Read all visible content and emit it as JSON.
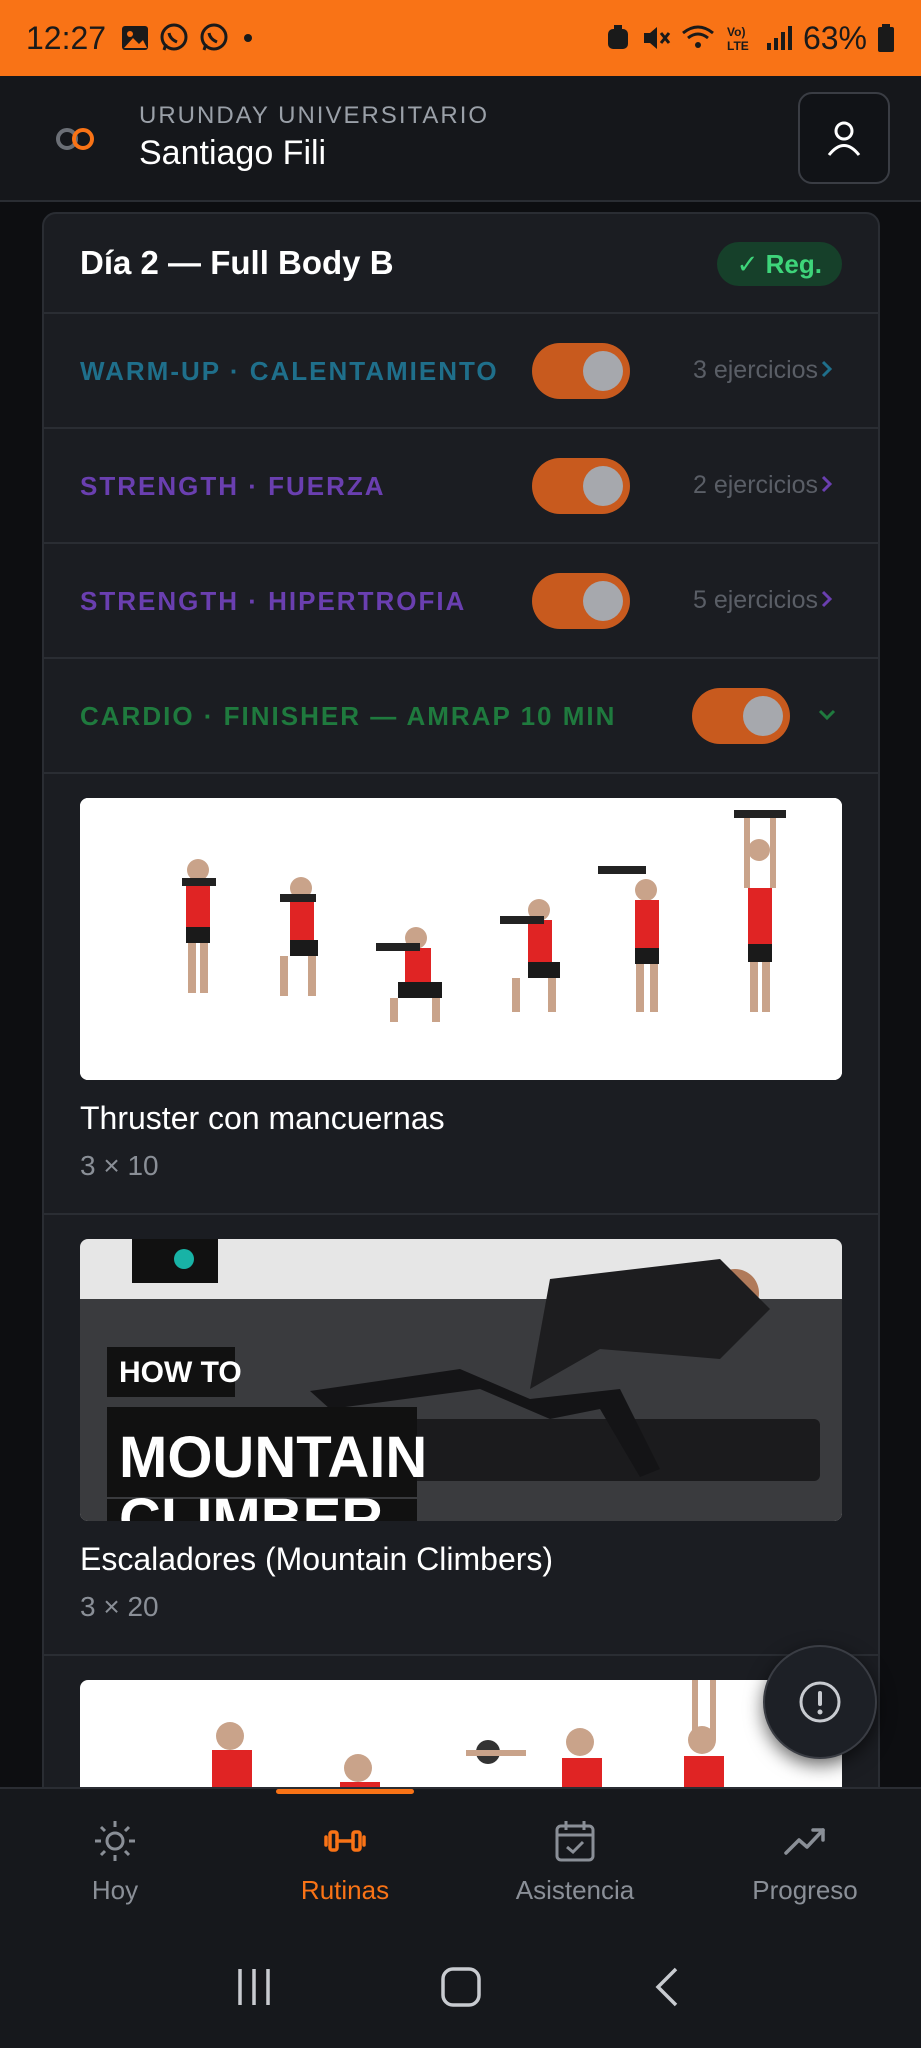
{
  "status_bar": {
    "time": "12:27",
    "battery": "63%"
  },
  "header": {
    "organization": "URUNDAY UNIVERSITARIO",
    "user_name": "Santiago Fili"
  },
  "day_card": {
    "title": "Día 2 — Full Body B",
    "badge": "✓ Reg.",
    "sections": [
      {
        "label": "WARM-UP · CALENTAMIENTO",
        "count": "3 ejercicios",
        "color": "#1f6f8b",
        "enabled": true,
        "expanded": false
      },
      {
        "label": "STRENGTH · FUERZA",
        "count": "2 ejercicios",
        "color": "#6a3fb0",
        "enabled": true,
        "expanded": false
      },
      {
        "label": "STRENGTH · HIPERTROFIA",
        "count": "5 ejercicios",
        "color": "#6a3fb0",
        "enabled": true,
        "expanded": false
      },
      {
        "label": "CARDIO · FINISHER — AMRAP 10 MIN",
        "count": "",
        "color": "#1f7a3e",
        "enabled": true,
        "expanded": true
      }
    ],
    "exercises": [
      {
        "name": "Thruster con mancuernas",
        "sets": "3 × 10"
      },
      {
        "name": "Escaladores (Mountain Climbers)",
        "sets": "3 × 20",
        "thumb_text_1": "HOW TO",
        "thumb_text_2": "MOUNTAIN",
        "thumb_text_3": "CLIMBER"
      }
    ]
  },
  "bottom_nav": {
    "tabs": [
      {
        "label": "Hoy",
        "icon": "sun-icon"
      },
      {
        "label": "Rutinas",
        "icon": "dumbbell-icon",
        "active": true
      },
      {
        "label": "Asistencia",
        "icon": "calendar-check-icon"
      },
      {
        "label": "Progreso",
        "icon": "trending-up-icon"
      }
    ]
  },
  "colors": {
    "accent": "#f97316",
    "badge_green": "#3ed47a",
    "toggle_on": "#c85a1e"
  }
}
